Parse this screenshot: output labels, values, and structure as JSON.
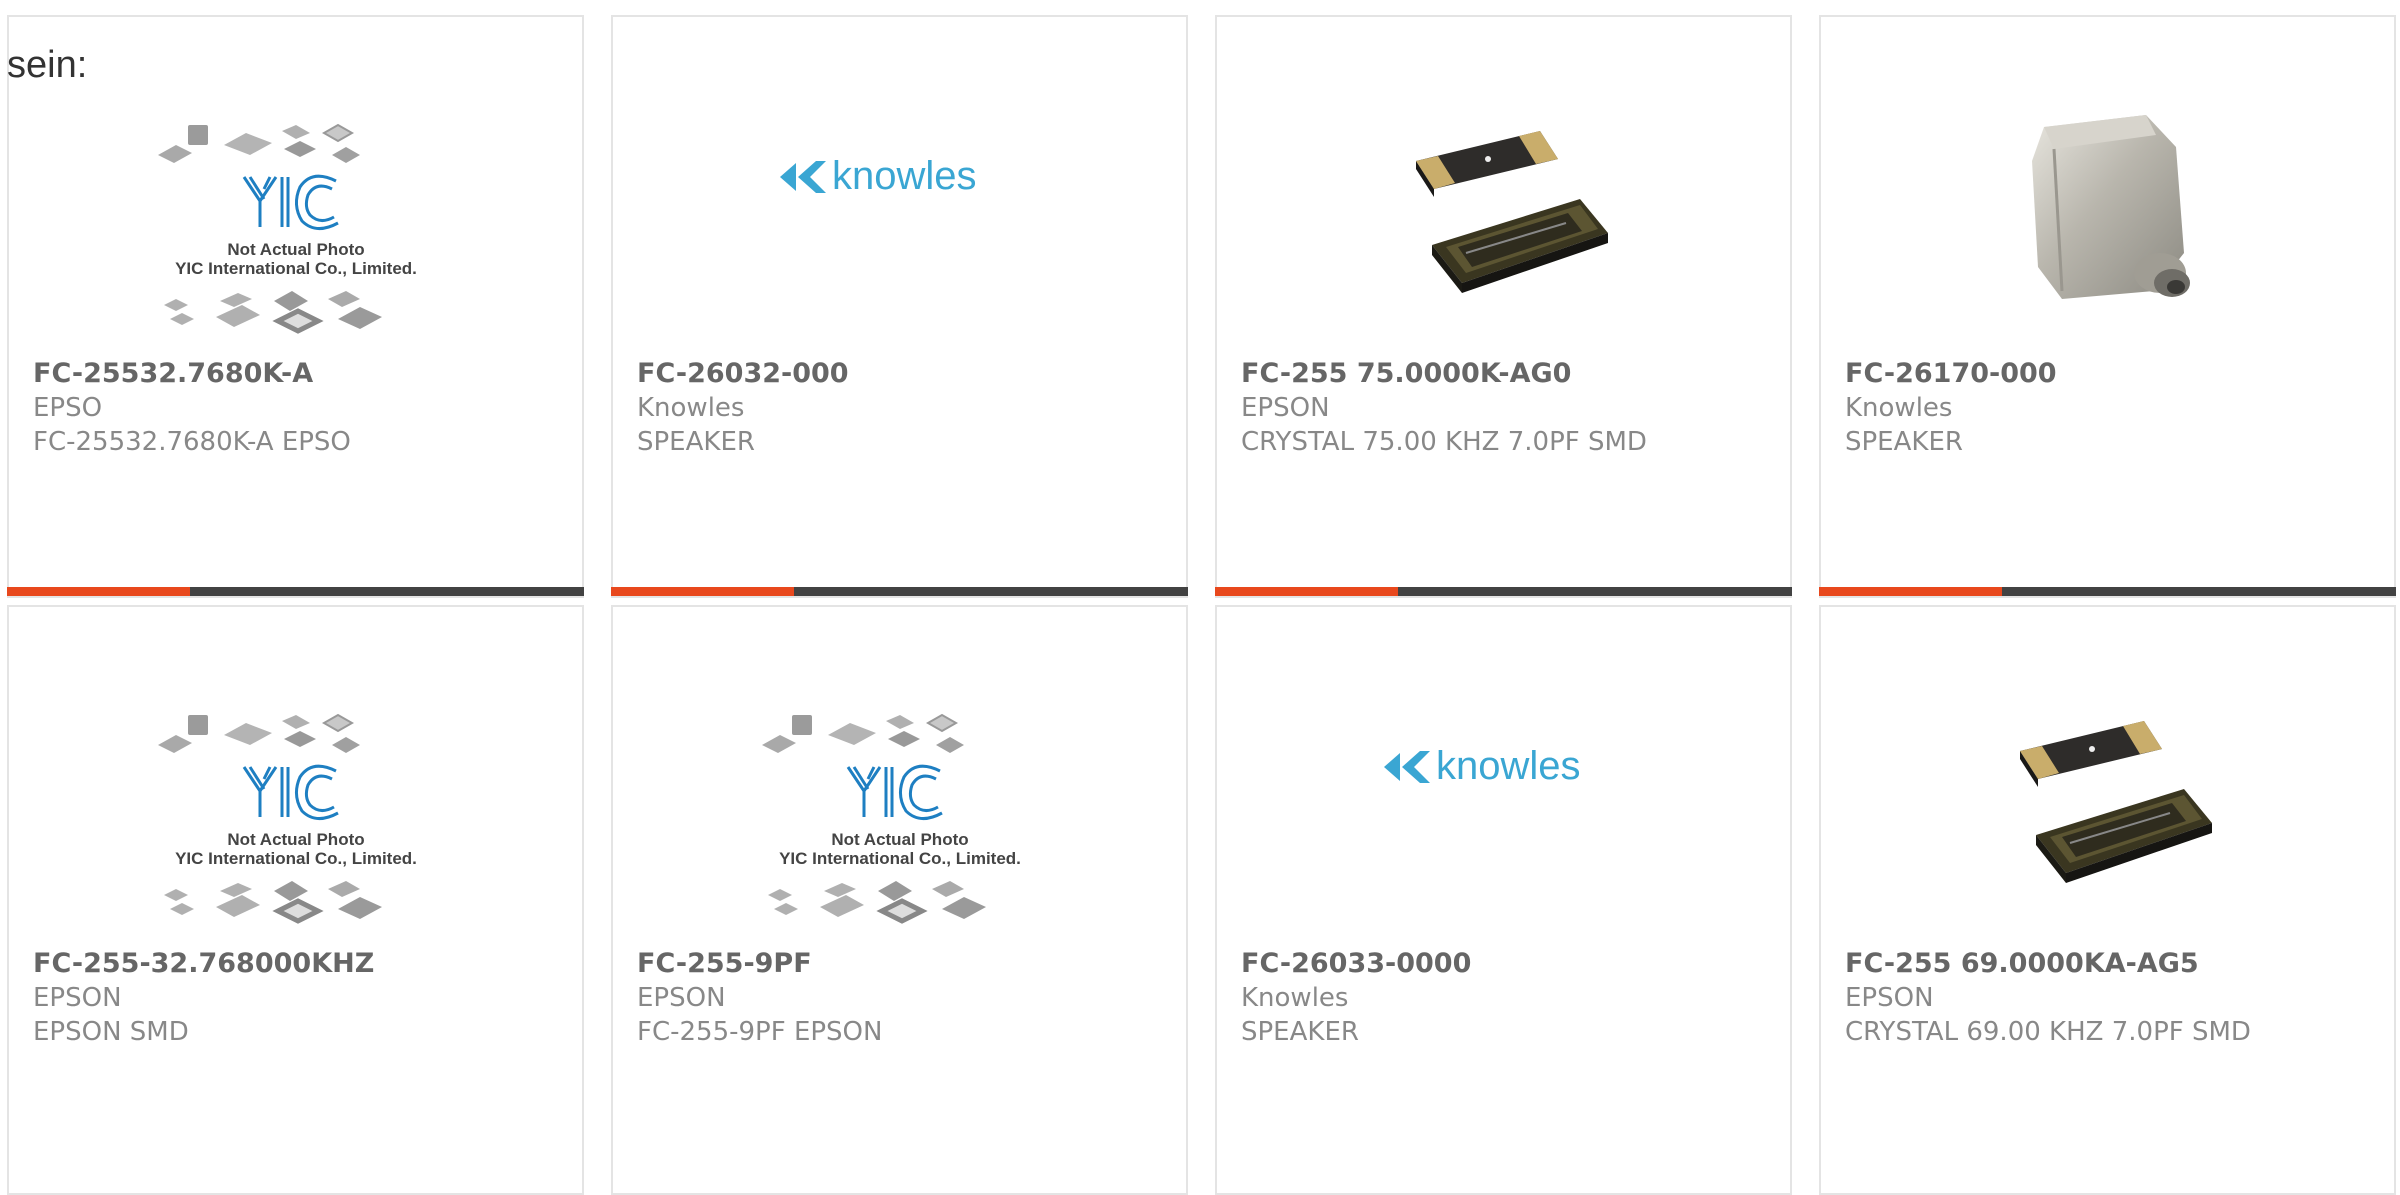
{
  "page": {
    "lead_text": "sein:"
  },
  "colors": {
    "accent": "#e8481d",
    "bar": "#424242",
    "border": "#e4e4e4",
    "knowles_blue": "#3aa6d3",
    "yic_blue": "#1e7fc2"
  },
  "products": [
    {
      "part": "FC-25532.7680K-A",
      "maker": "EPSO",
      "desc": "FC-25532.7680K-A EPSO",
      "image": "yic-placeholder"
    },
    {
      "part": "FC-26032-000",
      "maker": "Knowles",
      "desc": "SPEAKER",
      "image": "knowles-logo"
    },
    {
      "part": "FC-255 75.0000K-AG0",
      "maker": "EPSON",
      "desc": "CRYSTAL 75.00 KHZ 7.0PF SMD",
      "image": "crystal-photo"
    },
    {
      "part": "FC-26170-000",
      "maker": "Knowles",
      "desc": "SPEAKER",
      "image": "speaker-photo"
    },
    {
      "part": "FC-255-32.768000KHZ",
      "maker": "EPSON",
      "desc": "EPSON SMD",
      "image": "yic-placeholder"
    },
    {
      "part": "FC-255-9PF",
      "maker": "EPSON",
      "desc": "FC-255-9PF EPSON",
      "image": "yic-placeholder"
    },
    {
      "part": "FC-26033-0000",
      "maker": "Knowles",
      "desc": "SPEAKER",
      "image": "knowles-logo"
    },
    {
      "part": "FC-255 69.0000KA-AG5",
      "maker": "EPSON",
      "desc": "CRYSTAL 69.00 KHZ 7.0PF SMD",
      "image": "crystal-photo"
    }
  ],
  "images": {
    "yic_placeholder": {
      "logo": "YIC",
      "caption1": "Not Actual Photo",
      "caption2": "YIC International Co., Limited."
    },
    "knowles_logo": {
      "text": "knowles"
    }
  }
}
